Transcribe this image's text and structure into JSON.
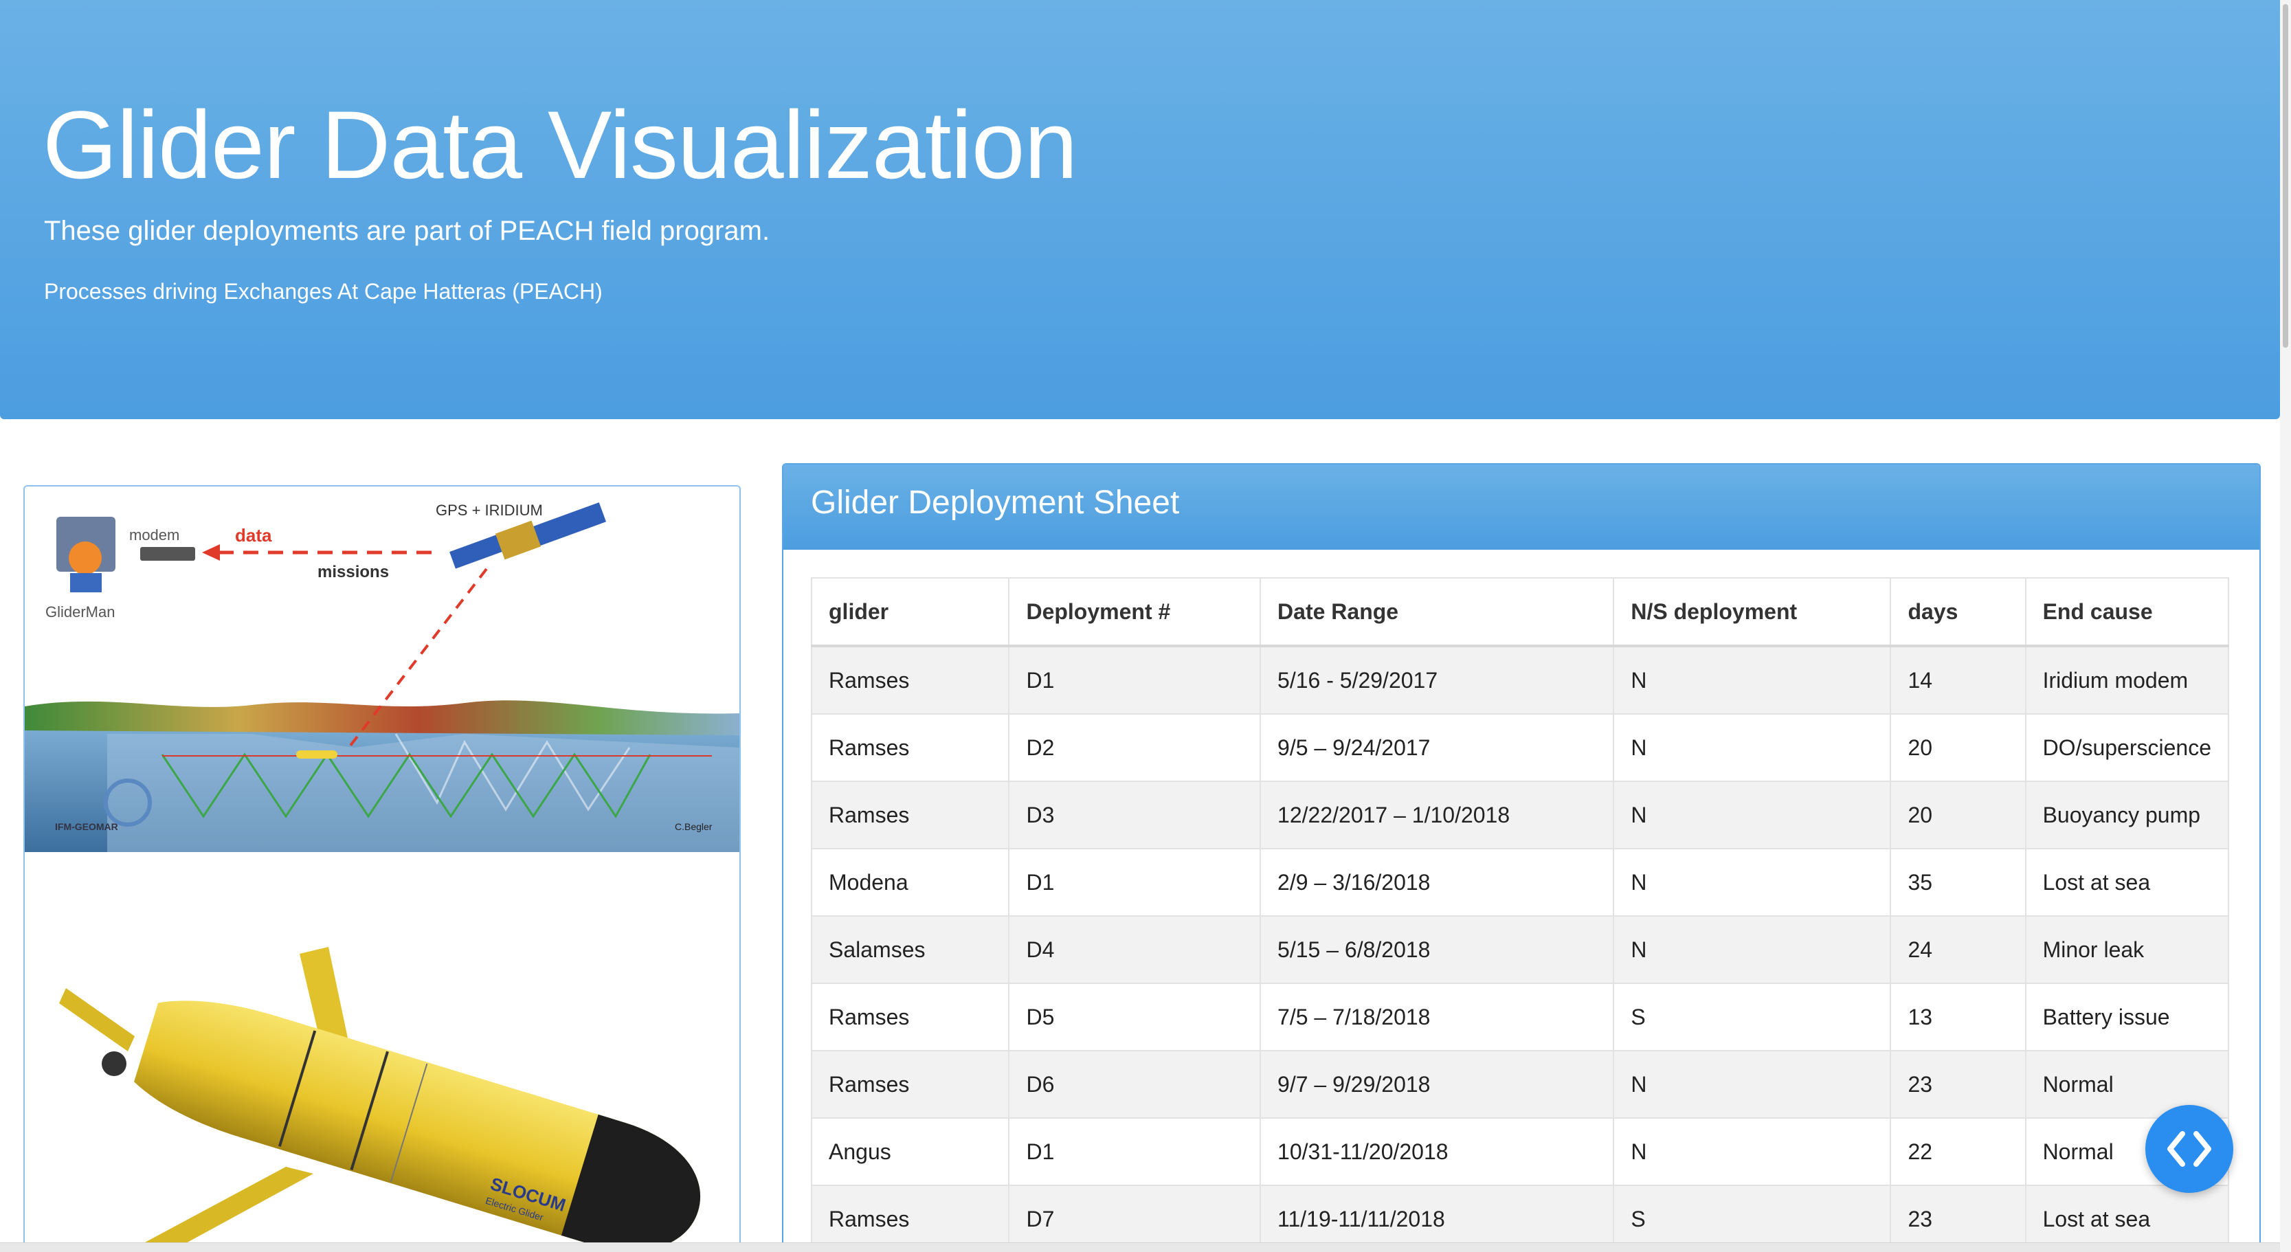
{
  "header": {
    "title": "Glider Data Visualization",
    "subtitle": "These glider deployments are part of PEACH field program.",
    "note": "Processes driving Exchanges At Cape Hatteras (PEACH)"
  },
  "diagram": {
    "satellite_label": "GPS + IRIDIUM",
    "modem_label": "modem",
    "data_label": "data",
    "missions_label": "missions",
    "station_label": "GliderMan",
    "logo_label": "IFM-GEOMAR",
    "credit_label": "C.Begler"
  },
  "glider_photo": {
    "brand_label": "SLOCUM",
    "brand_sublabel": "Electric Glider"
  },
  "panel": {
    "title": "Glider Deployment Sheet"
  },
  "table": {
    "headers": [
      "glider",
      "Deployment #",
      "Date Range",
      "N/S deployment",
      "days",
      "End cause"
    ],
    "rows": [
      [
        "Ramses",
        "D1",
        "5/16 - 5/29/2017",
        "N",
        "14",
        "Iridium modem"
      ],
      [
        "Ramses",
        "D2",
        "9/5 – 9/24/2017",
        "N",
        "20",
        "DO/superscience"
      ],
      [
        "Ramses",
        "D3",
        "12/22/2017 – 1/10/2018",
        "N",
        "20",
        "Buoyancy pump"
      ],
      [
        "Modena",
        "D1",
        "2/9 – 3/16/2018",
        "N",
        "35",
        "Lost at sea"
      ],
      [
        "Salamses",
        "D4",
        "5/15 – 6/8/2018",
        "N",
        "24",
        "Minor leak"
      ],
      [
        "Ramses",
        "D5",
        "7/5 – 7/18/2018",
        "S",
        "13",
        "Battery issue"
      ],
      [
        "Ramses",
        "D6",
        "9/7 – 9/29/2018",
        "N",
        "23",
        "Normal"
      ],
      [
        "Angus",
        "D1",
        "10/31-11/20/2018",
        "N",
        "22",
        "Normal"
      ],
      [
        "Ramses",
        "D7",
        "11/19-11/11/2018",
        "S",
        "23",
        "Lost at sea"
      ]
    ]
  },
  "colors": {
    "header_blue": "#5aa6e4",
    "fab_blue": "#2a8ef0",
    "glider_yellow": "#f2d23a"
  },
  "fab": {
    "icon": "code-icon"
  }
}
